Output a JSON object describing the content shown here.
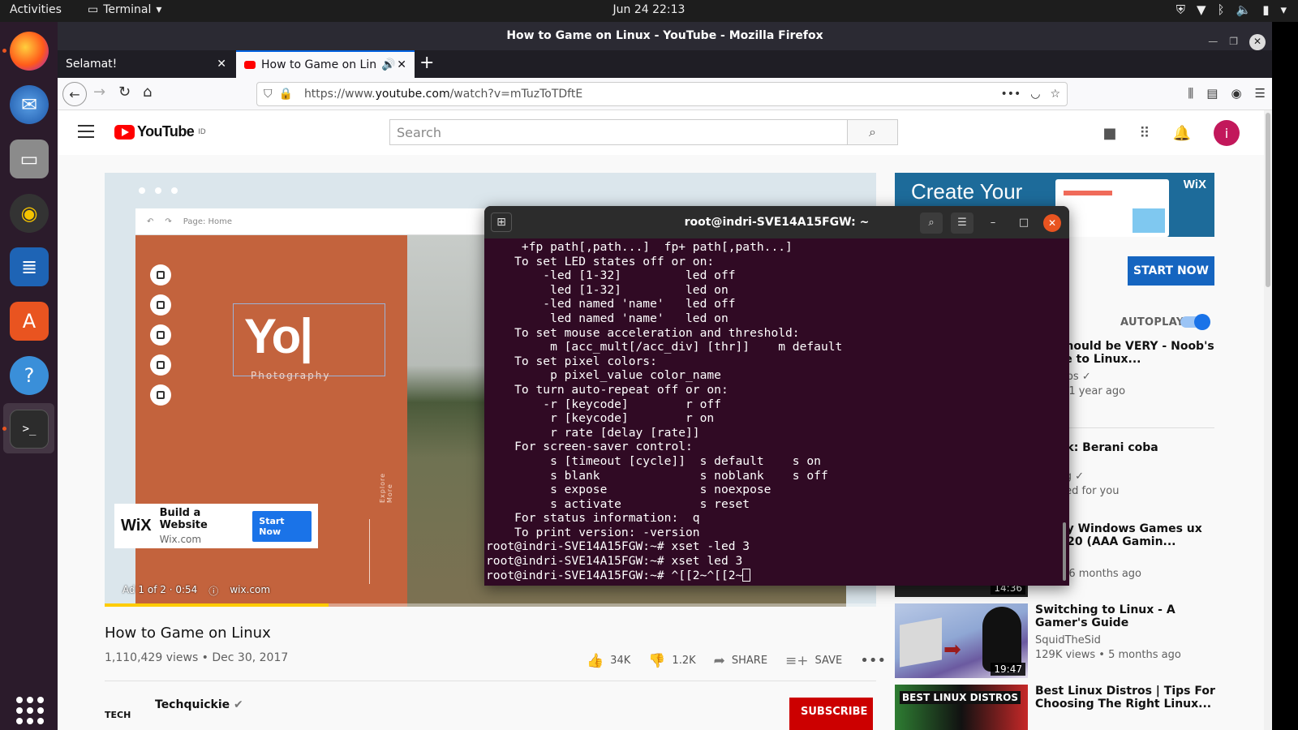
{
  "topbar": {
    "activities": "Activities",
    "app_name": "Terminal",
    "clock": "Jun 24  22:13"
  },
  "firefox": {
    "window_title": "How to Game on Linux - YouTube - Mozilla Firefox",
    "tabs": [
      {
        "label": "Selamat!"
      },
      {
        "label": "How to Game on Linux"
      }
    ],
    "url_prefix": "https://www.",
    "url_domain": "youtube.com",
    "url_path": "/watch?v=mTuzToTDftE"
  },
  "youtube": {
    "logo_text": "YouTube",
    "logo_region": "ID",
    "search_placeholder": "Search",
    "avatar_letter": "i",
    "ad_overlay": {
      "editor_page": "Page: Home",
      "hero_text": "Yo|",
      "hero_sub": "Photography",
      "explore": "Explore More",
      "card_logo": "WiX",
      "card_title": "Build a Website",
      "card_domain": "Wix.com",
      "card_button": "Start Now",
      "ad_counter": "Ad 1 of 2 · 0:54",
      "ad_link": "wix.com"
    },
    "video": {
      "title": "How to Game on Linux",
      "meta": "1,110,429 views • Dec 30, 2017",
      "likes": "34K",
      "dislikes": "1.2K",
      "share": "SHARE",
      "save": "SAVE"
    },
    "channel": {
      "logo_text": "TECH",
      "name": "Techquickie",
      "subscribe": "SUBSCRIBE"
    },
    "side_ad": {
      "headline": "Create Your",
      "brand": "WiX",
      "button": "START NOW"
    },
    "autoplay_label": "AUTOPLAY",
    "recommendations": [
      {
        "title": "oft Should be VERY - Noob's Guide to Linux...",
        "channel": "ech Tips ✓",
        "stats": "ews • 1 year ago",
        "duration": ""
      },
      {
        "title": "ol Yuk: Berani coba",
        "channel": "Belang ✓",
        "stats": "mended for you",
        "duration": ""
      },
      {
        "title": "o Play Windows Games ux in 2020 (AAA Gamin...",
        "channel": "V",
        "stats": "ews • 6 months ago",
        "duration": "14:36"
      },
      {
        "title": "Switching to Linux - A Gamer's Guide",
        "channel": "SquidTheSid",
        "stats": "129K views • 5 months ago",
        "duration": "19:47"
      },
      {
        "title": "Best Linux Distros | Tips For Choosing The Right Linux...",
        "channel": "",
        "stats": "",
        "duration": "",
        "thumb_text": "BEST LINUX DISTROS"
      }
    ]
  },
  "terminal": {
    "title": "root@indri-SVE14A15FGW: ~",
    "lines": [
      "     +fp path[,path...]  fp+ path[,path...]",
      "    To set LED states off or on:",
      "        -led [1-32]         led off",
      "         led [1-32]         led on",
      "        -led named 'name'   led off",
      "         led named 'name'   led on",
      "    To set mouse acceleration and threshold:",
      "         m [acc_mult[/acc_div] [thr]]    m default",
      "    To set pixel colors:",
      "         p pixel_value color_name",
      "    To turn auto-repeat off or on:",
      "        -r [keycode]        r off",
      "         r [keycode]        r on",
      "         r rate [delay [rate]]",
      "    For screen-saver control:",
      "         s [timeout [cycle]]  s default    s on",
      "         s blank              s noblank    s off",
      "         s expose             s noexpose",
      "         s activate           s reset",
      "    For status information:  q",
      "    To print version: -version",
      "root@indri-SVE14A15FGW:~# xset -led 3",
      "root@indri-SVE14A15FGW:~# xset led 3"
    ],
    "prompt_line": "root@indri-SVE14A15FGW:~# ^[[2~^[[2~"
  }
}
